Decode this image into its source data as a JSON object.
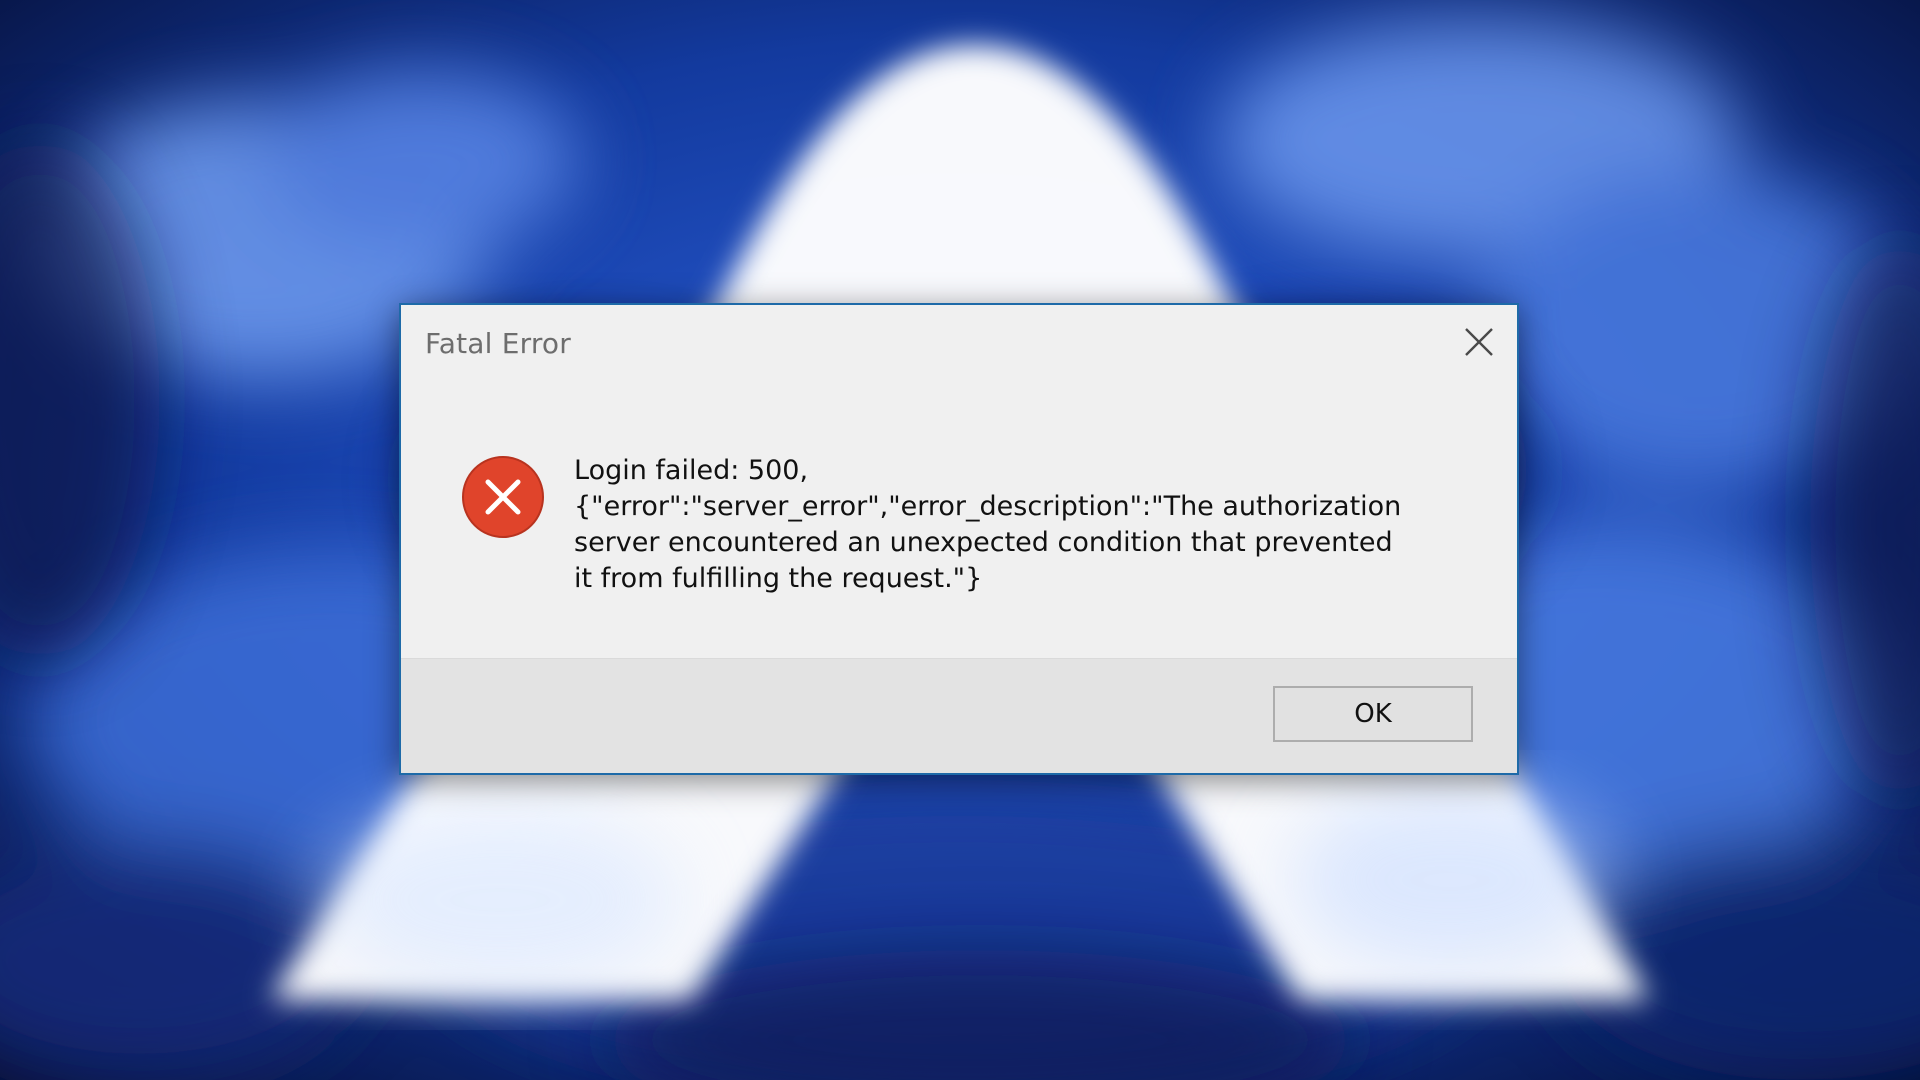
{
  "dialog": {
    "title": "Fatal Error",
    "message_lines": [
      "Login failed: 500,",
      "{\"error\":\"server_error\",\"error_description\":\"The authorization",
      "server encountered an unexpected condition that prevented",
      "it from fulfilling the request.\"}"
    ],
    "ok_label": "OK",
    "icons": {
      "close": "close-icon",
      "error": "error-icon"
    }
  },
  "colors": {
    "dialog_border": "#1e6aa8",
    "dialog_background": "#f0f0f0",
    "footer_background": "#e3e3e3",
    "error_red": "#e0442b",
    "title_text": "#6d6d6d"
  }
}
